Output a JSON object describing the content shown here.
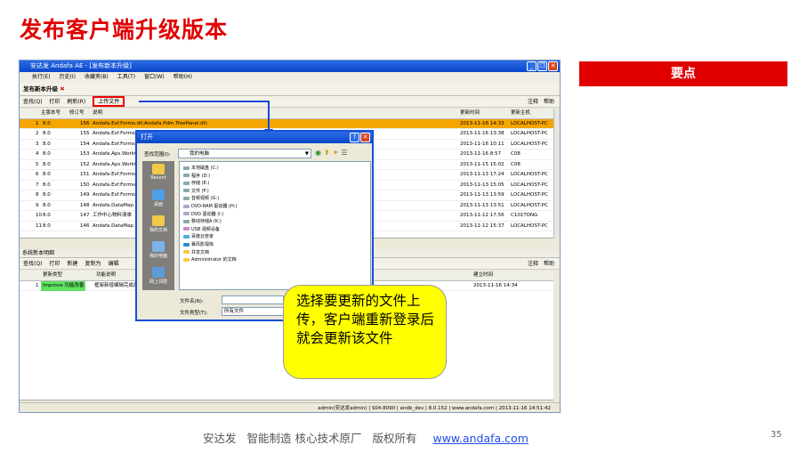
{
  "slide": {
    "title": "发布客户端升级版本",
    "keypoint": "要点",
    "page": "35",
    "footer": {
      "company": "安达发",
      "slogan": "智能制造 核心技术原厂",
      "rights": "版权所有",
      "url": "www.andafa.com"
    },
    "callout": "选择要更新的文件上传，客户端重新登录后就会更新该文件"
  },
  "app": {
    "title": "安达发 Andafa AE - [发布新本升级]",
    "menu": [
      "执行(E)",
      "历史(I)",
      "收藏夹(B)",
      "工具(T)",
      "窗口(W)",
      "帮助(H)"
    ],
    "subtitle": "发布新本升级",
    "toolbar": {
      "search": "查找(Q)",
      "print": "打印",
      "refresh": "刷新(R)",
      "upload": "上传文件",
      "note": "注释",
      "help": "帮助"
    },
    "grid": {
      "headers": [
        "主版本号",
        "修订号",
        "说明",
        "更新时间",
        "更新主机"
      ],
      "rows": [
        [
          "1",
          "8.0",
          "156",
          "Andafa.Exf.Forms.dll;Andafa.Pdm.TreePanel.dll;",
          "2013-11-16 14:33",
          "LOCALHOST-PC"
        ],
        [
          "2",
          "8.0",
          "155",
          "Andafa.Exf.Forms.dl",
          "2013-11-16 13:38",
          "LOCALHOST-PC"
        ],
        [
          "3",
          "8.0",
          "154",
          "Andafa.Exf.Forms.dl",
          "2013-11-16 10:11",
          "LOCALHOST-PC"
        ],
        [
          "4",
          "8.0",
          "153",
          "Andafa.Aps.WorkCen",
          "2013-11-16 8:57",
          "C08"
        ],
        [
          "5",
          "8.0",
          "152",
          "Andafa.Aps.WorkCen",
          "2013-11-15 15:02",
          "C08"
        ],
        [
          "6",
          "8.0",
          "151",
          "Andafa.Exf.Forms.dl",
          "2013-11-13 17:24",
          "LOCALHOST-PC"
        ],
        [
          "7",
          "8.0",
          "150",
          "Andafa.Exf.Forms.dl",
          "2013-11-13 15:05",
          "LOCALHOST-PC"
        ],
        [
          "8",
          "8.0",
          "149",
          "Andafa.Exf.Forms.dl",
          "2013-11-13 13:59",
          "LOCALHOST-PC"
        ],
        [
          "9",
          "8.0",
          "148",
          "Andafa.DataMap.dll",
          "2013-11-13 13:51",
          "LOCALHOST-PC"
        ],
        [
          "10",
          "8.0",
          "147",
          "工作中心物料清单",
          "2013-11-12 17:56",
          "C101TONG"
        ],
        [
          "11",
          "8.0",
          "146",
          "Andafa.DataMap.dll",
          "2013-11-12 15:37",
          "LOCALHOST-PC"
        ]
      ]
    },
    "panel2": {
      "tab": "系统新本明细",
      "toolbar": {
        "search": "查找(Q)",
        "print": "打印",
        "new": "新建",
        "copy": "复制为",
        "edit": "编辑",
        "note": "注释",
        "help": "帮助"
      },
      "headers": [
        "更新类型",
        "功能说明",
        "建立时间"
      ],
      "row": [
        "1",
        "Improve 功能改善",
        "框架新增编辑完成后",
        "2013-11-16 14:34"
      ]
    },
    "status": {
      "user": "admin(安达发admin)",
      "server": "S04:8090",
      "db": "andb_dev",
      "ip": "8.0.152",
      "site": "www.andafa.com",
      "time": "2013-11-16 14:51:42"
    }
  },
  "dialog": {
    "title": "打开",
    "lookin_label": "查找范围(I):",
    "lookin_value": "我的电脑",
    "places": [
      "Recent",
      "桌面",
      "我的文档",
      "我的电脑",
      "网上邻居"
    ],
    "items": [
      "本地磁盘 (C:)",
      "程序 (D:)",
      "存储 (E:)",
      "文件 (F:)",
      "音频视频 (G:)",
      "DVD-RAM 驱动器 (H:)",
      "DVD 驱动器 (I:)",
      "移动存储A (K:)",
      "USB 视频设备",
      "百度云管家",
      "暴风影视库",
      "共享文档",
      "Administrator 的文档"
    ],
    "filename_label": "文件名(N):",
    "filetype_label": "文件类型(T):",
    "filetype_value": "所有文件"
  }
}
